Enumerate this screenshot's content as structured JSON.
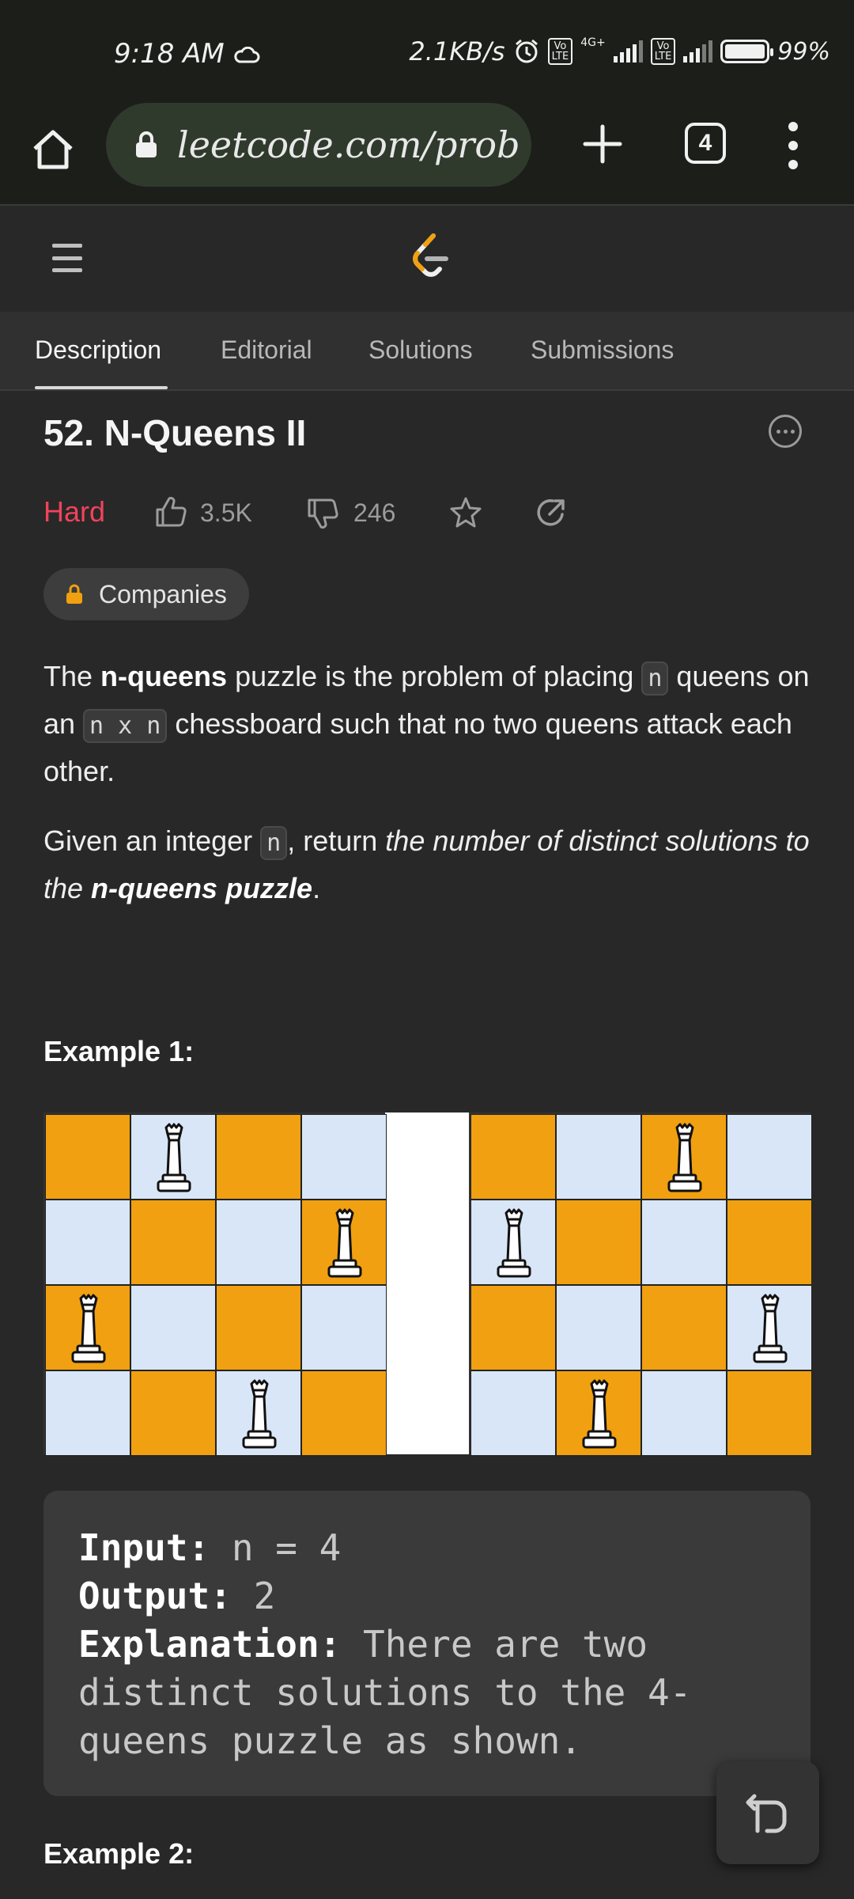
{
  "status_bar": {
    "time": "9:18 AM",
    "net_speed": "2.1KB/s",
    "battery": "99%",
    "sim1_label": "Vo LTE",
    "sim2_label": "Vo LTE",
    "network": "4G+"
  },
  "browser": {
    "url": "leetcode.com/prob",
    "tab_count": "4"
  },
  "tabs": [
    {
      "label": "Description",
      "active": true
    },
    {
      "label": "Editorial",
      "active": false
    },
    {
      "label": "Solutions",
      "active": false
    },
    {
      "label": "Submissions",
      "active": false
    }
  ],
  "problem": {
    "title": "52. N-Queens II",
    "difficulty": "Hard",
    "likes": "3.5K",
    "dislikes": "246",
    "companies_label": "Companies",
    "description": {
      "p1_a": "The ",
      "p1_bold": "n-queens",
      "p1_b": " puzzle is the problem of placing ",
      "p1_code1": "n",
      "p1_c": " queens on an ",
      "p1_code2": "n x n",
      "p1_d": " chessboard such that no two queens attack each other.",
      "p2_a": "Given an integer ",
      "p2_code": "n",
      "p2_b": ", return ",
      "p2_italic": "the number of distinct solutions to the ",
      "p2_bold_italic": "n-queens puzzle",
      "p2_c": "."
    }
  },
  "example1": {
    "title": "Example 1:",
    "input_label": "Input:",
    "input_value": " n = 4",
    "output_label": "Output:",
    "output_value": " 2",
    "explanation_label": "Explanation:",
    "explanation_line1": " There are two",
    "explanation_line2": "distinct solutions to the 4-",
    "explanation_line3": "queens puzzle as shown."
  },
  "example2": {
    "title": "Example 2:"
  },
  "boards": [
    {
      "queens": [
        1,
        3,
        0,
        2
      ]
    },
    {
      "queens": [
        2,
        0,
        3,
        1
      ]
    }
  ],
  "colors": {
    "background": "#282828",
    "difficulty_hard": "#f0435a",
    "board_orange": "#f0a010",
    "board_light": "#d8e6f7"
  },
  "icons": [
    "home-icon",
    "lock-icon",
    "plus-icon",
    "tabs-icon",
    "more-vert-icon",
    "hamburger-icon",
    "leetcode-logo-icon",
    "more-horiz-icon",
    "thumbs-up-icon",
    "thumbs-down-icon",
    "star-icon",
    "share-icon",
    "queen-icon",
    "reset-code-icon"
  ]
}
